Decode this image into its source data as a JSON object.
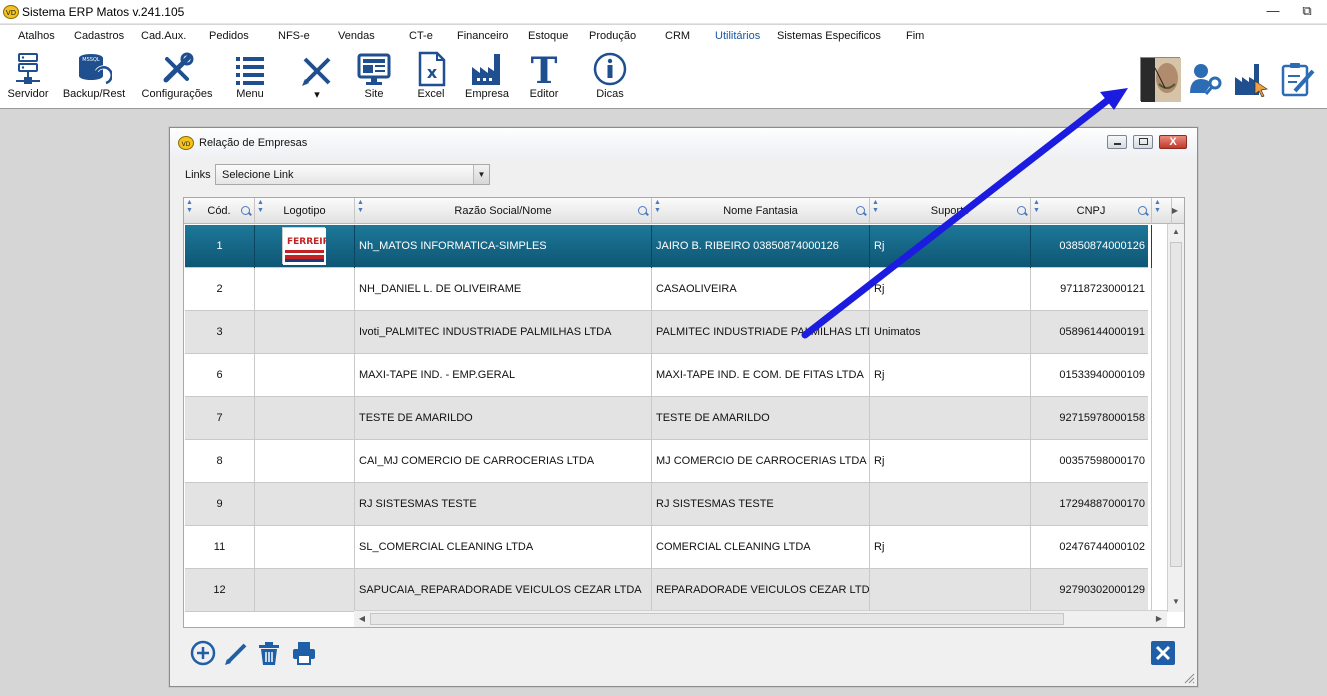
{
  "window": {
    "title": "Sistema ERP Matos v.241.105",
    "minimize": "—",
    "restore": "⧉"
  },
  "menu": [
    "Atalhos",
    "Cadastros",
    "Cad.Aux.",
    "Pedidos",
    "NFS-e",
    "Vendas",
    "CT-e",
    "Financeiro",
    "Estoque",
    "Produção",
    "CRM",
    "Utilitários",
    "Sistemas Especificos",
    "Fim"
  ],
  "menu_active": "Utilitários",
  "toolbar": {
    "servidor": "Servidor",
    "backup": "Backup/Rest",
    "configuracoes": "Configurações",
    "menu": "Menu",
    "tools": "▾",
    "site": "Site",
    "excel": "Excel",
    "empresa": "Empresa",
    "editor": "Editor",
    "dicas": "Dicas",
    "backup_badge": "MSSQL"
  },
  "dialog": {
    "title": "Relação de Empresas",
    "links_label": "Links",
    "links_value": "Selecione Link",
    "close_label": "X",
    "columns": [
      "Cód.",
      "Logotipo",
      "Razão Social/Nome",
      "Nome Fantasia",
      "Suporte",
      "CNPJ"
    ],
    "rows": [
      {
        "cod": "1",
        "razao": "Nh_MATOS INFORMATICA-SIMPLES",
        "fantasia": "JAIRO B. RIBEIRO 03850874000126",
        "suporte": "Rj",
        "cnpj": "03850874000126",
        "logo": "FERREIRA"
      },
      {
        "cod": "2",
        "razao": "NH_DANIEL L. DE OLIVEIRAME",
        "fantasia": "CASAOLIVEIRA",
        "suporte": "Rj",
        "cnpj": "97118723000121"
      },
      {
        "cod": "3",
        "razao": "Ivoti_PALMITEC INDUSTRIADE PALMILHAS LTDA",
        "fantasia": "PALMITEC INDUSTRIADE PALMILHAS LTDA",
        "suporte": "Unimatos",
        "cnpj": "05896144000191"
      },
      {
        "cod": "6",
        "razao": "MAXI-TAPE IND. - EMP.GERAL",
        "fantasia": "MAXI-TAPE IND. E COM. DE FITAS LTDA",
        "suporte": "Rj",
        "cnpj": "01533940000109"
      },
      {
        "cod": "7",
        "razao": "TESTE DE AMARILDO",
        "fantasia": "TESTE DE AMARILDO",
        "suporte": "",
        "cnpj": "92715978000158"
      },
      {
        "cod": "8",
        "razao": "CAI_MJ COMERCIO DE CARROCERIAS LTDA",
        "fantasia": "MJ COMERCIO DE CARROCERIAS LTDA",
        "suporte": "Rj",
        "cnpj": "00357598000170"
      },
      {
        "cod": "9",
        "razao": "RJ SISTESMAS TESTE",
        "fantasia": "RJ SISTESMAS TESTE",
        "suporte": "",
        "cnpj": "17294887000170"
      },
      {
        "cod": "11",
        "razao": "SL_COMERCIAL CLEANING LTDA",
        "fantasia": "COMERCIAL CLEANING LTDA",
        "suporte": "Rj",
        "cnpj": "02476744000102"
      },
      {
        "cod": "12",
        "razao": "SAPUCAIA_REPARADORADE VEICULOS CEZAR LTDA",
        "fantasia": "REPARADORADE VEICULOS CEZAR LTDA",
        "suporte": "",
        "cnpj": "92790302000129"
      }
    ]
  },
  "colors": {
    "accent": "#1a55a6",
    "selected_row": "#136583",
    "arrow": "#1c1ce0"
  }
}
